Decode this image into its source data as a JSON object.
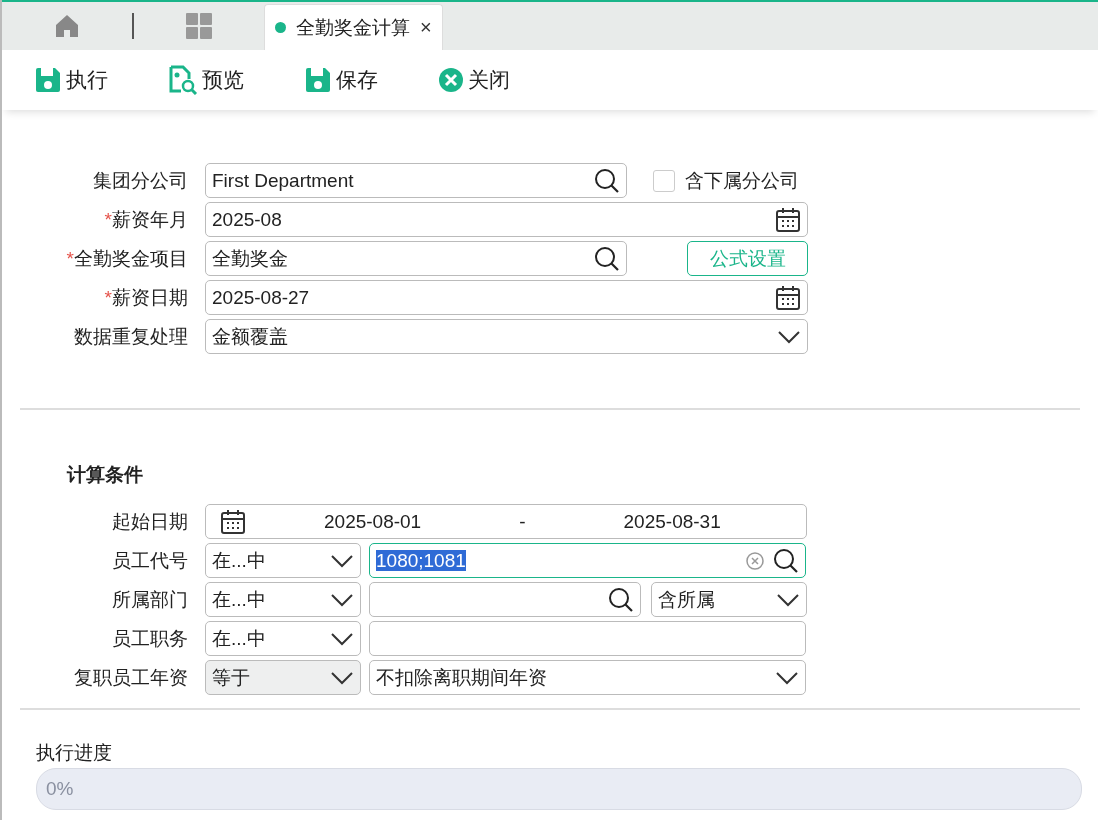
{
  "tabs": [
    {
      "label": "全勤奖金计算",
      "selected": true,
      "close": "×"
    }
  ],
  "toolbar": [
    {
      "kind": "save",
      "label": "执行"
    },
    {
      "kind": "preview",
      "label": "预览"
    },
    {
      "kind": "save",
      "label": "保存"
    },
    {
      "kind": "close",
      "label": "关闭"
    }
  ],
  "form": [
    {
      "label": "集团分公司",
      "kind": "search",
      "value": "First Department",
      "extra": {
        "kind": "checkbox",
        "label": "含下属分公司",
        "checked": false
      }
    },
    {
      "mark": "*",
      "label": "薪资年月",
      "kind": "date",
      "value": "2025-08"
    },
    {
      "mark": "*",
      "label": "全勤奖金项目",
      "kind": "search",
      "value": "全勤奖金",
      "extra": {
        "kind": "button",
        "label": "公式设置"
      }
    },
    {
      "mark": "*",
      "label": "薪资日期",
      "kind": "date",
      "value": "2025-08-27"
    },
    {
      "label": "数据重复处理",
      "kind": "select",
      "value": "金额覆盖"
    }
  ],
  "conditions": {
    "title": "计算条件",
    "rows": [
      {
        "kind": "range",
        "label": "起始日期",
        "from": "2025-08-01",
        "separator": "-",
        "to": "2025-08-31"
      },
      {
        "kind": "filter",
        "label": "员工代号",
        "operator": "在...中",
        "disabled": false,
        "input": {
          "kind": "search",
          "value": "1080;1081",
          "focused": true,
          "highlighted": true
        }
      },
      {
        "kind": "filter",
        "label": "所属部门",
        "operator": "在...中",
        "disabled": false,
        "input": {
          "kind": "search",
          "focused": false
        },
        "scope": "含所属"
      },
      {
        "kind": "filter",
        "label": "员工职务",
        "operator": "在...中",
        "disabled": false,
        "input": {
          "kind": "text",
          "focused": false
        }
      },
      {
        "kind": "filter",
        "label": "复职员工年资",
        "operator": "等于",
        "disabled": true,
        "input": {
          "kind": "select",
          "value": "不扣除离职期间年资",
          "focused": false
        }
      }
    ]
  },
  "progress": {
    "label": "执行进度",
    "level": 0,
    "reading": "0%"
  }
}
